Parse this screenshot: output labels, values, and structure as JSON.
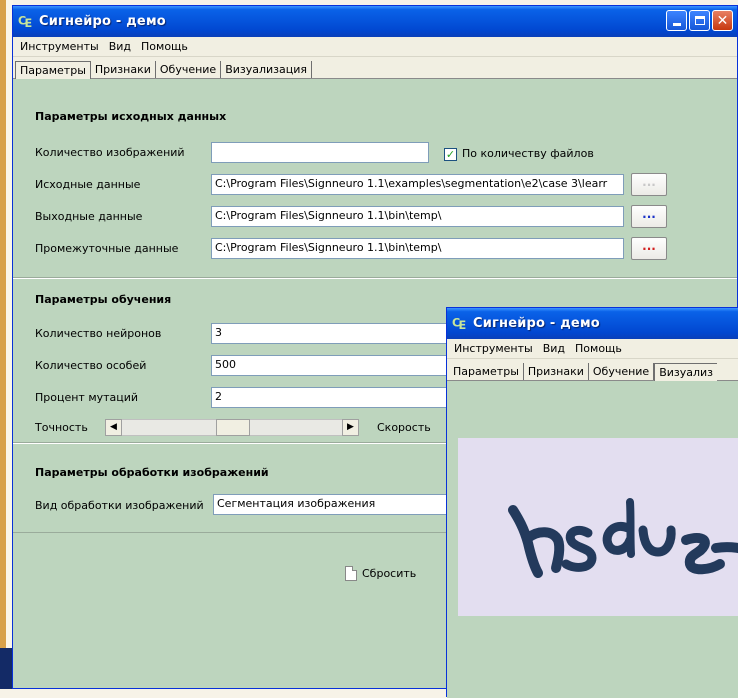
{
  "main_window": {
    "title": "Сигнейро - демо",
    "menu": [
      "Инструменты",
      "Вид",
      "Помощь"
    ],
    "tabs": [
      "Параметры",
      "Признаки",
      "Обучение",
      "Визуализация"
    ],
    "active_tab": "Параметры",
    "input_section": {
      "title": "Параметры исходных данных",
      "image_count_label": "Количество изображений",
      "image_count_value": "",
      "by_file_count_label": "По количеству файлов",
      "by_file_count_checked": true,
      "source_label": "Исходные данные",
      "source_value": "C:\\Program Files\\Signneuro 1.1\\examples\\segmentation\\e2\\case 3\\learr",
      "output_label": "Выходные данные",
      "output_value": "C:\\Program Files\\Signneuro 1.1\\bin\\temp\\",
      "intermediate_label": "Промежуточные данные",
      "intermediate_value": "C:\\Program Files\\Signneuro 1.1\\bin\\temp\\",
      "browse_label": "..."
    },
    "training_section": {
      "title": "Параметры обучения",
      "neurons_label": "Количество нейронов",
      "neurons_value": "3",
      "individuals_label": "Количество особей",
      "individuals_value": "500",
      "mutation_label": "Процент мутаций",
      "mutation_value": "2",
      "accuracy_label": "Точность",
      "speed_label": "Скорость",
      "left_arrow": "◀",
      "right_arrow": "▶"
    },
    "processing_section": {
      "title": "Параметры обработки изображений",
      "type_label": "Вид обработки изображений",
      "type_value": "Сегментация изображения"
    },
    "reset_label": "Сбросить"
  },
  "second_window": {
    "title": "Сигнейро - демо",
    "menu": [
      "Инструменты",
      "Вид",
      "Помощь"
    ],
    "tabs": [
      "Параметры",
      "Признаки",
      "Обучение",
      "Визуализ"
    ],
    "active_tab": "Визуализ",
    "captcha_text": "nsdue"
  },
  "colors": {
    "panel_bg": "#bdd5be",
    "title_blue": "#0553db",
    "captcha_bg": "#e3def0",
    "captcha_ink": "#233a5c"
  }
}
